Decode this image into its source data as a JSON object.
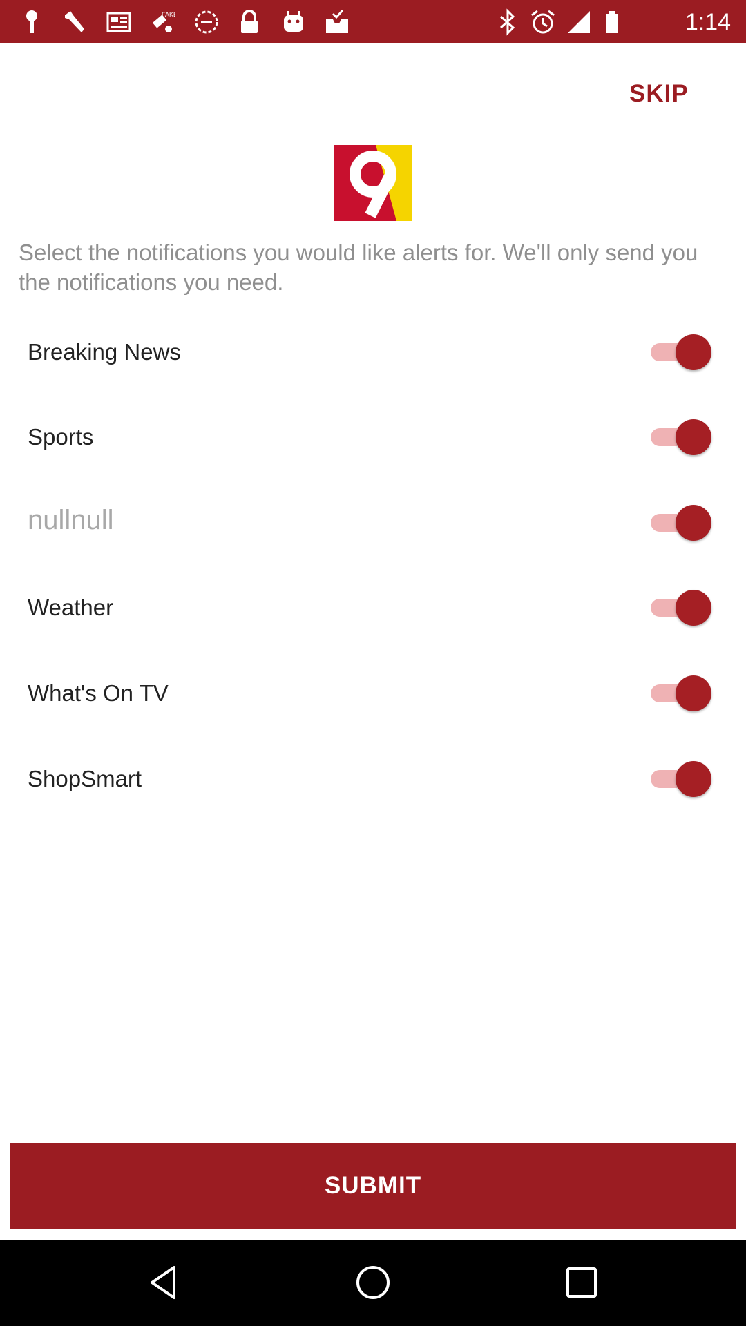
{
  "status_bar": {
    "time": "1:14",
    "left_icons": [
      "key-icon",
      "wrench-icon",
      "newspaper-icon",
      "fake-gps-icon",
      "blocked-icon",
      "lock-icon",
      "android-icon",
      "inbox-check-icon"
    ],
    "right_icons": [
      "bluetooth-icon",
      "alarm-icon",
      "signal-icon",
      "battery-icon"
    ]
  },
  "header": {
    "skip_label": "SKIP"
  },
  "logo": {
    "text": "9",
    "colors": [
      "#c8102e",
      "#f5d400"
    ]
  },
  "intro_text": "Select the notifications you would like alerts for. We'll only send you the notifications you need.",
  "notifications": [
    {
      "label": "Breaking News",
      "enabled": true
    },
    {
      "label": "Sports",
      "enabled": true
    },
    {
      "label": "nullnull",
      "enabled": true
    },
    {
      "label": "Weather",
      "enabled": true
    },
    {
      "label": "What's On TV",
      "enabled": true
    },
    {
      "label": "ShopSmart",
      "enabled": true
    }
  ],
  "submit_label": "SUBMIT",
  "theme": {
    "accent": "#9b1c22",
    "toggle_track": "#efb2b4",
    "toggle_thumb": "#a51f24"
  },
  "nav_bar": {
    "buttons": [
      "back-icon",
      "home-icon",
      "recents-icon"
    ]
  }
}
